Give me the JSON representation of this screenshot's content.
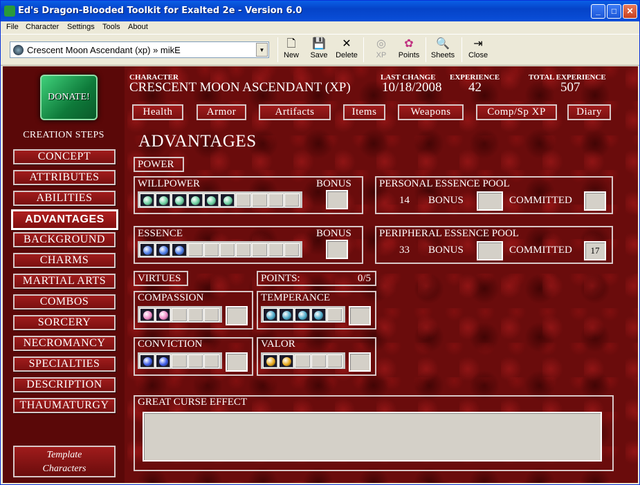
{
  "window": {
    "title": "Ed's Dragon-Blooded Toolkit for Exalted 2e - Version 6.0",
    "minimize": "_",
    "maximize": "□",
    "close": "✕"
  },
  "menu": [
    "File",
    "Character",
    "Settings",
    "Tools",
    "About"
  ],
  "toolbar": {
    "character_select": "Crescent Moon Ascendant (xp) » mikE",
    "buttons": [
      {
        "label": "New",
        "icon": "new-document-icon",
        "glyph": "🗋"
      },
      {
        "label": "Save",
        "icon": "save-disk-icon",
        "glyph": "💾"
      },
      {
        "label": "Delete",
        "icon": "delete-x-icon",
        "glyph": "✕"
      },
      {
        "label": "XP",
        "icon": "xp-icon",
        "glyph": "◎"
      },
      {
        "label": "Points",
        "icon": "points-icon",
        "glyph": "✿"
      },
      {
        "label": "Sheets",
        "icon": "sheets-icon",
        "glyph": "🔍"
      },
      {
        "label": "Close",
        "icon": "close-door-icon",
        "glyph": "⇥"
      }
    ]
  },
  "sidebar": {
    "donate": "DONATE!",
    "creation_steps_label": "CREATION STEPS",
    "steps": [
      "Concept",
      "Attributes",
      "Abilities",
      "Advantages",
      "Background",
      "Charms",
      "Martial Arts",
      "Combos",
      "Sorcery",
      "Necromancy",
      "Specialties",
      "Description",
      "Thaumaturgy"
    ],
    "active_step": "Advantages",
    "template_line1": "Template",
    "template_line2": "Characters"
  },
  "header": {
    "character_label": "CHARACTER",
    "character_value": "CRESCENT MOON ASCENDANT (XP)",
    "last_change_label": "LAST CHANGE",
    "last_change_value": "10/18/2008",
    "experience_label": "EXPERIENCE",
    "experience_value": "42",
    "total_experience_label": "TOTAL EXPERIENCE",
    "total_experience_value": "507"
  },
  "nav_tabs": [
    "Health",
    "Armor",
    "Artifacts",
    "Items",
    "Weapons",
    "Comp/Sp XP",
    "Diary"
  ],
  "advantages": {
    "title": "ADVANTAGES",
    "power_label": "POWER",
    "willpower": {
      "label": "WILLPOWER",
      "bonus_label": "BONUS",
      "filled": 6,
      "total": 10
    },
    "essence": {
      "label": "ESSENCE",
      "bonus_label": "BONUS",
      "filled": 3,
      "total": 10
    },
    "personal_pool": {
      "label": "PERSONAL ESSENCE POOL",
      "value": "14",
      "bonus_label": "BONUS",
      "committed_label": "COMMITTED",
      "committed_value": ""
    },
    "peripheral_pool": {
      "label": "PERIPHERAL ESSENCE POOL",
      "value": "33",
      "bonus_label": "BONUS",
      "committed_label": "COMMITTED",
      "committed_value": "17"
    },
    "virtues_label": "VIRTUES",
    "points_label": "POINTS:",
    "points_value": "0/5",
    "virtues": [
      {
        "label": "COMPASSION",
        "filled": 2,
        "gem_color": "#f08ac8"
      },
      {
        "label": "TEMPERANCE",
        "filled": 4,
        "gem_color": "#4aa8c8"
      },
      {
        "label": "CONVICTION",
        "filled": 2,
        "gem_color": "#3a5ae8"
      },
      {
        "label": "VALOR",
        "filled": 2,
        "gem_color": "#e8a818"
      }
    ],
    "great_curse_label": "GREAT CURSE EFFECT",
    "great_curse_value": ""
  }
}
